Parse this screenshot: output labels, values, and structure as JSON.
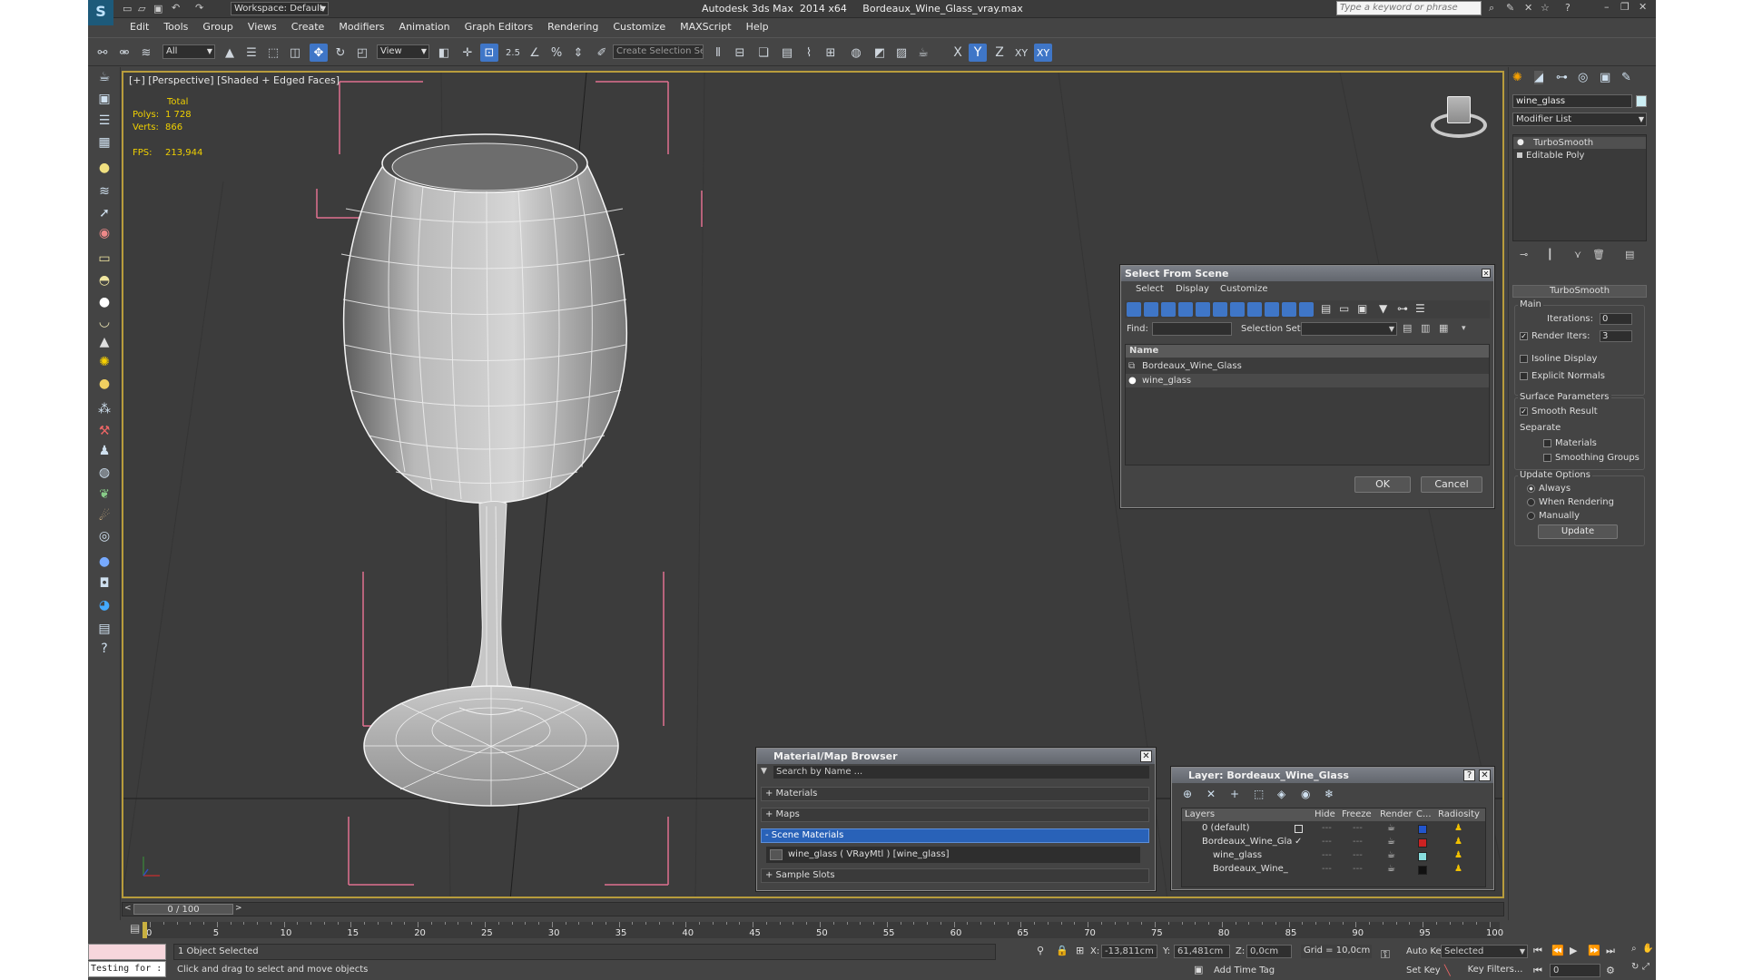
{
  "titlebar": {
    "workspace_label": "Workspace: Default",
    "title": "Autodesk 3ds Max  2014 x64     Bordeaux_Wine_Glass_vray.max",
    "search_placeholder": "Type a keyword or phrase"
  },
  "menu": [
    "Edit",
    "Tools",
    "Group",
    "Views",
    "Create",
    "Modifiers",
    "Animation",
    "Graph Editors",
    "Rendering",
    "Customize",
    "MAXScript",
    "Help"
  ],
  "toolbar": {
    "filter_value": "All",
    "refcoord_value": "View",
    "selection_set_placeholder": "Create Selection Se",
    "snap_label": "2.5",
    "axis_x": "X",
    "axis_y": "Y",
    "axis_z": "Z",
    "axis_xy": "XY",
    "axis_xy2": "XY"
  },
  "viewport": {
    "label": "[+] [Perspective] [Shaded + Edged Faces]",
    "stats_header": "Total",
    "polys_label": "Polys:",
    "polys_value": "1 728",
    "verts_label": "Verts:",
    "verts_value": "866",
    "fps_label": "FPS:",
    "fps_value": "213,944"
  },
  "command_panel": {
    "object_name": "wine_glass",
    "modifier_list": "Modifier List",
    "stack": [
      "TurboSmooth",
      "Editable Poly"
    ],
    "rollout_title": "TurboSmooth",
    "main_group": "Main",
    "iterations_label": "Iterations:",
    "iterations_value": "0",
    "render_iters_label": "Render Iters:",
    "render_iters_value": "3",
    "isoline": "Isoline Display",
    "explicit_normals": "Explicit Normals",
    "surface_group": "Surface Parameters",
    "smooth_result": "Smooth Result",
    "separate": "Separate",
    "materials": "Materials",
    "smoothing_groups": "Smoothing Groups",
    "update_group": "Update Options",
    "always": "Always",
    "when_rendering": "When Rendering",
    "manually": "Manually",
    "update_button": "Update"
  },
  "select_dialog": {
    "title": "Select From Scene",
    "menus": [
      "Select",
      "Display",
      "Customize"
    ],
    "find_label": "Find:",
    "selection_set_label": "Selection Set:",
    "column_name": "Name",
    "items": [
      "Bordeaux_Wine_Glass",
      "wine_glass"
    ],
    "ok": "OK",
    "cancel": "Cancel"
  },
  "material_browser": {
    "title": "Material/Map Browser",
    "search_placeholder": "Search by Name ...",
    "groups": [
      "+ Materials",
      "+ Maps",
      "- Scene Materials"
    ],
    "scene_material": "wine_glass  ( VRayMtl ) [wine_glass]",
    "sample_slots": "+ Sample Slots"
  },
  "layer_dialog": {
    "title": "Layer: Bordeaux_Wine_Glass",
    "columns": [
      "Layers",
      "Hide",
      "Freeze",
      "Render",
      "C...",
      "Radiosity"
    ],
    "rows": [
      "0 (default)",
      "Bordeaux_Wine_Gla",
      "wine_glass",
      "Bordeaux_Wine_"
    ],
    "row_colors": [
      "#2255cc",
      "#cc2222",
      "#88dddd",
      "#111111"
    ]
  },
  "timeline": {
    "frame_label": "0 / 100",
    "ticks": [
      "0",
      "5",
      "10",
      "15",
      "20",
      "25",
      "30",
      "35",
      "40",
      "45",
      "50",
      "55",
      "60",
      "65",
      "70",
      "75",
      "80",
      "85",
      "90",
      "95",
      "100"
    ]
  },
  "status": {
    "script_field": "Testing for :",
    "selected_text": "1 Object Selected",
    "prompt_text": "Click and drag to select and move objects",
    "x_label": "X:",
    "x_value": "-13,811cm",
    "y_label": "Y:",
    "y_value": "61,481cm",
    "z_label": "Z:",
    "z_value": "0,0cm",
    "grid": "Grid = 10,0cm",
    "add_time_tag": "Add Time Tag",
    "auto_key": "Auto Key",
    "set_key": "Set Key",
    "selected_dropdown": "Selected",
    "key_filters": "Key Filters...",
    "frame_value": "0"
  }
}
